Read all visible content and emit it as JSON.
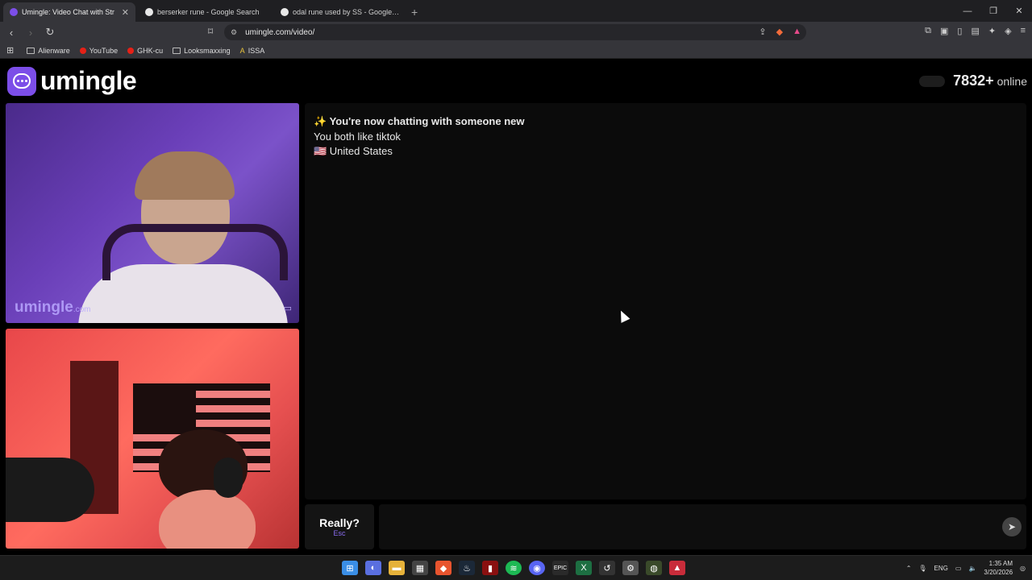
{
  "browser": {
    "tabs": [
      {
        "title": "Umingle: Video Chat with Str",
        "active": true
      },
      {
        "title": "berserker rune - Google Search",
        "active": false
      },
      {
        "title": "odal rune used by SS - Google Search",
        "active": false
      }
    ],
    "url": "umingle.com/video/",
    "bookmarks": [
      "Alienware",
      "YouTube",
      "GHK-cu",
      "Looksmaxxing",
      "ISSA"
    ]
  },
  "site": {
    "logo_text": "umingle",
    "online_count": "7832+",
    "online_label": "online"
  },
  "video": {
    "watermark": "umingle",
    "watermark_suffix": ".com"
  },
  "chat": {
    "messages": [
      {
        "text": "✨ You're now chatting with someone new",
        "bold": true
      },
      {
        "text": "You both like tiktok",
        "bold": false
      },
      {
        "text": "🇺🇸 United States",
        "bold": false
      }
    ]
  },
  "controls": {
    "skip_label": "Really?",
    "skip_hint": "Esc",
    "message_placeholder": ""
  },
  "taskbar": {
    "lang": "ENG",
    "time": "1:35 AM",
    "date": "3/20/2026"
  },
  "colors": {
    "brand": "#7c4ee8",
    "chat_bg": "#0b0b0b"
  }
}
